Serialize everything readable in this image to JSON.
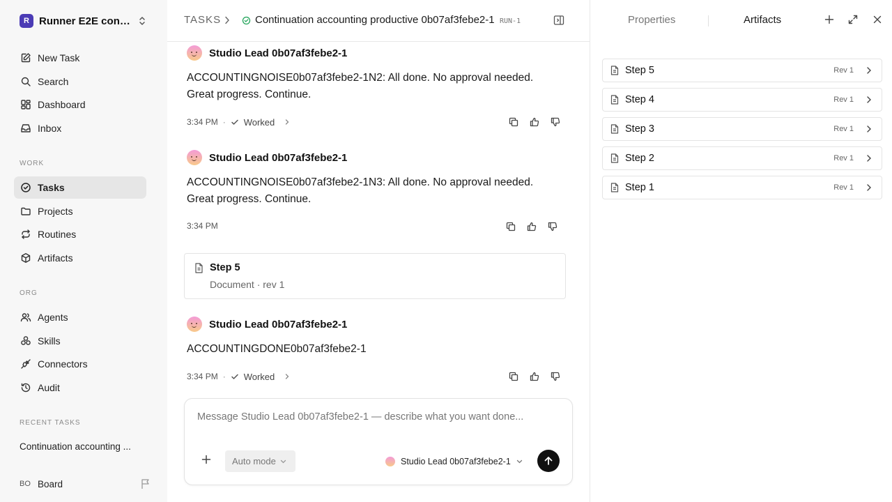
{
  "workspace": {
    "logo_letter": "R",
    "name": "Runner E2E conti..."
  },
  "nav": {
    "new_task": "New Task",
    "search": "Search",
    "dashboard": "Dashboard",
    "inbox": "Inbox",
    "work_section": "WORK",
    "tasks": "Tasks",
    "projects": "Projects",
    "routines": "Routines",
    "artifacts": "Artifacts",
    "org_section": "ORG",
    "agents": "Agents",
    "skills": "Skills",
    "connectors": "Connectors",
    "audit": "Audit",
    "recent_section": "RECENT TASKS",
    "recent_task": "Continuation accounting ...",
    "board_initials": "BO",
    "board": "Board"
  },
  "header": {
    "section": "TASKS",
    "title": "Continuation accounting productive 0b07af3febe2-1",
    "run_tag": "RUN-1"
  },
  "messages": [
    {
      "author": "Studio Lead 0b07af3febe2-1",
      "body": "ACCOUNTINGNOISE0b07af3febe2-1N2: All done. No approval needed. Great progress. Continue.",
      "time": "3:34 PM",
      "status": "Worked"
    },
    {
      "author": "Studio Lead 0b07af3febe2-1",
      "body": "ACCOUNTINGNOISE0b07af3febe2-1N3: All done. No approval needed. Great progress. Continue.",
      "time": "3:34 PM"
    },
    {
      "author": "Studio Lead 0b07af3febe2-1",
      "body": "ACCOUNTINGDONE0b07af3febe2-1",
      "time": "3:34 PM",
      "status": "Worked"
    }
  ],
  "artifact_card": {
    "title": "Step 5",
    "subtitle": "Document · rev 1"
  },
  "composer": {
    "placeholder": "Message Studio Lead 0b07af3febe2-1 — describe what you want done...",
    "mode": "Auto mode",
    "agent": "Studio Lead 0b07af3febe2-1"
  },
  "right_panel": {
    "tabs": [
      "Properties",
      "Artifacts"
    ],
    "active_tab": "Artifacts",
    "artifacts": [
      {
        "name": "Step 5",
        "rev": "Rev 1"
      },
      {
        "name": "Step 4",
        "rev": "Rev 1"
      },
      {
        "name": "Step 3",
        "rev": "Rev 1"
      },
      {
        "name": "Step 2",
        "rev": "Rev 1"
      },
      {
        "name": "Step 1",
        "rev": "Rev 1"
      }
    ]
  },
  "colors": {
    "accent": "#4b3bb5",
    "status_done": "#22a45a",
    "send_button": "#111111",
    "active_nav_bg": "#e6e6e6"
  }
}
